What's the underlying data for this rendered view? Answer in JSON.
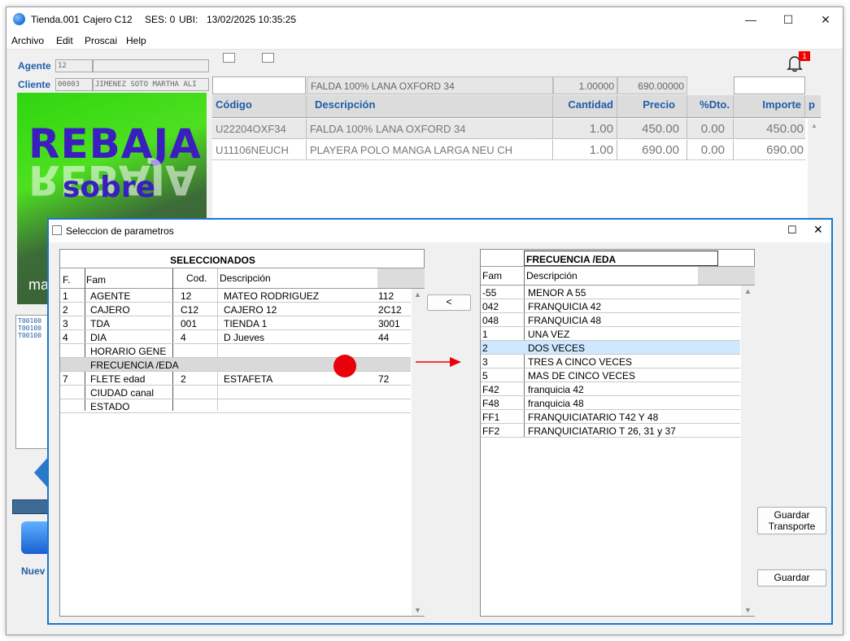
{
  "window": {
    "title": "Tienda.001",
    "cajero": "Cajero C12",
    "ses": "SES: 0",
    "ubi": "UBI:",
    "datetime": "13/02/2025 10:35:25",
    "minimize": "—",
    "maximize": "☐",
    "close": "✕"
  },
  "menu": [
    "Archivo",
    "Edit",
    "Proscai",
    "Help"
  ],
  "header": {
    "agente_label": "Agente",
    "agente_code": "12",
    "cliente_label": "Cliente",
    "cliente_code": "00003",
    "cliente_name": "JIMENEZ SOTO MARTHA ALI",
    "notification_count": "1"
  },
  "entry": {
    "description": "FALDA 100% LANA OXFORD 34",
    "cantidad": "1.00000",
    "precio": "690.00000"
  },
  "grid": {
    "headers": [
      "Código",
      "Descripción",
      "Cantidad",
      "Precio",
      "%Dto.",
      "Importe",
      "p"
    ],
    "rows": [
      [
        "U22204OXF34",
        "FALDA 100% LANA OXFORD 34",
        "1.00",
        "450.00",
        "0.00",
        "450.00"
      ],
      [
        "U11106NEUCH",
        "PLAYERA POLO MANGA LARGA NEU CH",
        "1.00",
        "690.00",
        "0.00",
        "690.00"
      ]
    ]
  },
  "promo": {
    "big": "REBAJA",
    "sobre": "sobre",
    "fragment": "ma"
  },
  "side": {
    "list": [
      "T00100",
      "T00100",
      "T00100"
    ],
    "nuevo": "Nuev"
  },
  "dialog": {
    "title": "Seleccion de parametros",
    "left_title": "SELECCIONADOS",
    "left_headers": [
      "F.",
      "Fam",
      "Cod.",
      "Descripción"
    ],
    "left_rows": [
      [
        "1",
        "AGENTE",
        "12",
        "MATEO RODRIGUEZ",
        "112"
      ],
      [
        "2",
        "CAJERO",
        "C12",
        "CAJERO 12",
        "2C12"
      ],
      [
        "3",
        "TDA",
        "001",
        "TIENDA 1",
        "3001"
      ],
      [
        "4",
        "DIA",
        "4",
        "D Jueves",
        "44"
      ],
      [
        "",
        "HORARIO GENE",
        "",
        "",
        ""
      ],
      [
        "",
        "FRECUENCIA /EDA",
        "",
        "",
        ""
      ],
      [
        "7",
        "FLETE edad",
        "2",
        "ESTAFETA",
        "72"
      ],
      [
        "",
        "CIUDAD canal",
        "",
        "",
        ""
      ],
      [
        "",
        "ESTADO",
        "",
        "",
        ""
      ]
    ],
    "move_left_label": "<",
    "right_title": "FRECUENCIA /EDA",
    "right_headers": [
      "Fam",
      "Descripción"
    ],
    "right_rows": [
      [
        "-55",
        "MENOR A 55"
      ],
      [
        "042",
        "FRANQUICIA 42"
      ],
      [
        "048",
        "FRANQUICIA 48"
      ],
      [
        "1",
        "UNA VEZ"
      ],
      [
        "2",
        "DOS VECES"
      ],
      [
        "3",
        "TRES A CINCO VECES"
      ],
      [
        "5",
        "MAS DE CINCO VECES"
      ],
      [
        "F42",
        "franquicia 42"
      ],
      [
        "F48",
        "franquicia 48"
      ],
      [
        "FF1",
        "FRANQUICIATARIO T42 Y 48"
      ],
      [
        "FF2",
        "FRANQUICIATARIO T 26, 31 y 37"
      ]
    ],
    "guardar_transporte_1": "Guardar",
    "guardar_transporte_2": "Transporte",
    "guardar": "Guardar"
  },
  "colors": {
    "accent_blue": "#1f5ea8",
    "dialog_border": "#1a78c8",
    "selection": "#cde8ff",
    "marker_red": "#e8000a"
  }
}
